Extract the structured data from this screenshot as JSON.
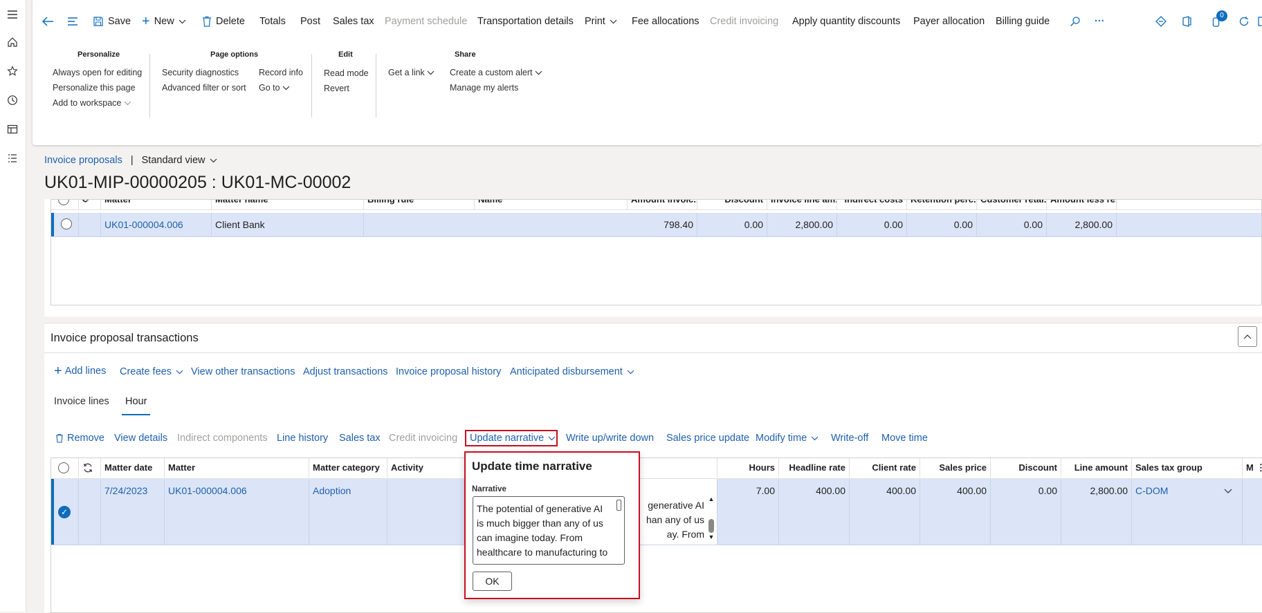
{
  "toolbar": {
    "save": "Save",
    "new": "New",
    "delete": "Delete",
    "totals": "Totals",
    "post": "Post",
    "sales_tax": "Sales tax",
    "payment_schedule": "Payment schedule",
    "transportation_details": "Transportation details",
    "print": "Print",
    "fee_allocations": "Fee allocations",
    "credit_invoicing": "Credit invoicing",
    "apply_quantity_discounts": "Apply quantity discounts",
    "payer_allocation": "Payer allocation",
    "billing_guide": "Billing guide",
    "more": "···",
    "notification_count": "0"
  },
  "ribbon": {
    "personalize": {
      "header": "Personalize",
      "items": [
        "Always open for editing",
        "Personalize this page",
        "Add to workspace"
      ]
    },
    "page_options": {
      "header": "Page options",
      "security_diagnostics": "Security diagnostics",
      "advanced_filter": "Advanced filter or sort",
      "record_info": "Record info",
      "go_to": "Go to"
    },
    "edit": {
      "header": "Edit",
      "read_mode": "Read mode",
      "revert": "Revert"
    },
    "get_a_link": "Get a link",
    "share": {
      "header": "Share",
      "create_custom_alert": "Create a custom alert",
      "manage_my_alerts": "Manage my alerts"
    }
  },
  "breadcrumb": {
    "link": "Invoice proposals",
    "separator": "|",
    "view": "Standard view"
  },
  "page_title": "UK01-MIP-00000205 : UK01-MC-00002",
  "top_grid": {
    "headers": [
      "Matter",
      "Matter name",
      "Billing rule",
      "Name",
      "Amount invoic...",
      "Discount",
      "Invoice line am...",
      "Indirect costs",
      "Retention perc...",
      "Customer retai...",
      "Amount less re..."
    ],
    "row": [
      "UK01-000004.006",
      "Client Bank",
      "",
      "",
      "798.40",
      "0.00",
      "2,800.00",
      "0.00",
      "0.00",
      "0.00",
      "2,800.00"
    ]
  },
  "section": {
    "title": "Invoice proposal transactions",
    "actions": {
      "add_lines": "Add lines",
      "create_fees": "Create fees",
      "view_other_transactions": "View other transactions",
      "adjust_transactions": "Adjust transactions",
      "invoice_proposal_history": "Invoice proposal history",
      "anticipated_disbursement": "Anticipated disbursement"
    },
    "tabs": {
      "invoice_lines": "Invoice lines",
      "hour": "Hour"
    },
    "sub_actions": {
      "remove": "Remove",
      "view_details": "View details",
      "indirect_components": "Indirect components",
      "line_history": "Line history",
      "sales_tax": "Sales tax",
      "credit_invoicing": "Credit invoicing",
      "update_narrative": "Update narrative",
      "write_up_down": "Write up/write down",
      "sales_price_update": "Sales price update",
      "modify_time": "Modify time",
      "write_off": "Write-off",
      "move_time": "Move time"
    }
  },
  "bottom_grid": {
    "headers": {
      "matter_date": "Matter date",
      "matter": "Matter",
      "matter_category": "Matter category",
      "activity": "Activity",
      "hours": "Hours",
      "headline_rate": "Headline rate",
      "client_rate": "Client rate",
      "sales_price": "Sales price",
      "discount": "Discount",
      "line_amount": "Line amount",
      "sales_tax_group": "Sales tax group",
      "m": "M"
    },
    "row": {
      "matter_date": "7/24/2023",
      "matter": "UK01-000004.006",
      "matter_category": "Adoption",
      "activity": "",
      "narrative_preview": "generative AI\nhan any of us\nay. From\nnufacturing",
      "hours": "7.00",
      "headline_rate": "400.00",
      "client_rate": "400.00",
      "sales_price": "400.00",
      "discount": "0.00",
      "line_amount": "2,800.00",
      "sales_tax_group": "C-DOM"
    }
  },
  "dialog": {
    "title": "Update time narrative",
    "field_label": "Narrative",
    "narrative_text": "The potential of generative AI is much bigger than any of us can imagine today. From healthcare to manufacturing to",
    "ok": "OK"
  },
  "colors": {
    "accent": "#0f6cbd",
    "link": "#1f5fad",
    "highlight_border": "#c50f1f",
    "selected_row": "#dbe5f7"
  }
}
